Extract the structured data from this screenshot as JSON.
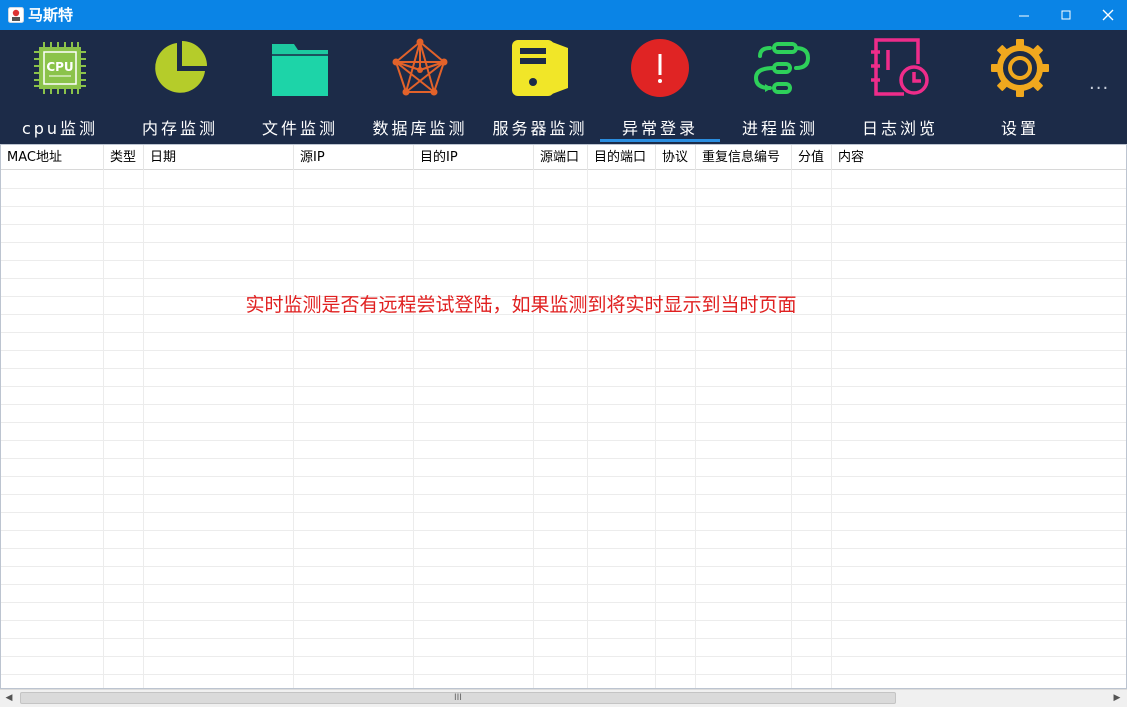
{
  "window": {
    "title": "马斯特",
    "controls": [
      "minimize",
      "maximize",
      "close"
    ]
  },
  "toolbar": {
    "items": [
      {
        "label": "cpu监测",
        "icon": "cpu-icon",
        "color": "#8bc34a",
        "active": false
      },
      {
        "label": "内存监测",
        "icon": "pie-chart-icon",
        "color": "#b5cc2a",
        "active": false
      },
      {
        "label": "文件监测",
        "icon": "folder-icon",
        "color": "#1dc9a0",
        "active": false
      },
      {
        "label": "数据库监测",
        "icon": "network-icon",
        "color": "#e2622a",
        "active": false
      },
      {
        "label": "服务器监测",
        "icon": "server-icon",
        "color": "#f1e628",
        "active": false
      },
      {
        "label": "异常登录",
        "icon": "alert-icon",
        "color": "#e02424",
        "active": true
      },
      {
        "label": "进程监测",
        "icon": "process-flow-icon",
        "color": "#2ed05a",
        "active": false
      },
      {
        "label": "日志浏览",
        "icon": "log-clock-icon",
        "color": "#ee2c8a",
        "active": false
      },
      {
        "label": "设置",
        "icon": "gear-icon",
        "color": "#f0a81e",
        "active": false
      }
    ],
    "more": "..."
  },
  "table": {
    "columns": [
      "MAC地址",
      "类型",
      "日期",
      "源IP",
      "目的IP",
      "源端口",
      "目的端口",
      "协议",
      "重复信息编号",
      "分值",
      "内容"
    ],
    "rows": [],
    "notice": "实时监测是否有远程尝试登陆，如果监测到将实时显示到当时页面"
  },
  "scrollbar": {
    "grip": "III"
  },
  "colors": {
    "titlebar": "#0a84e6",
    "toolbar": "#1c2b48",
    "active_underline": "#2b8ee0",
    "notice": "#e02020"
  }
}
